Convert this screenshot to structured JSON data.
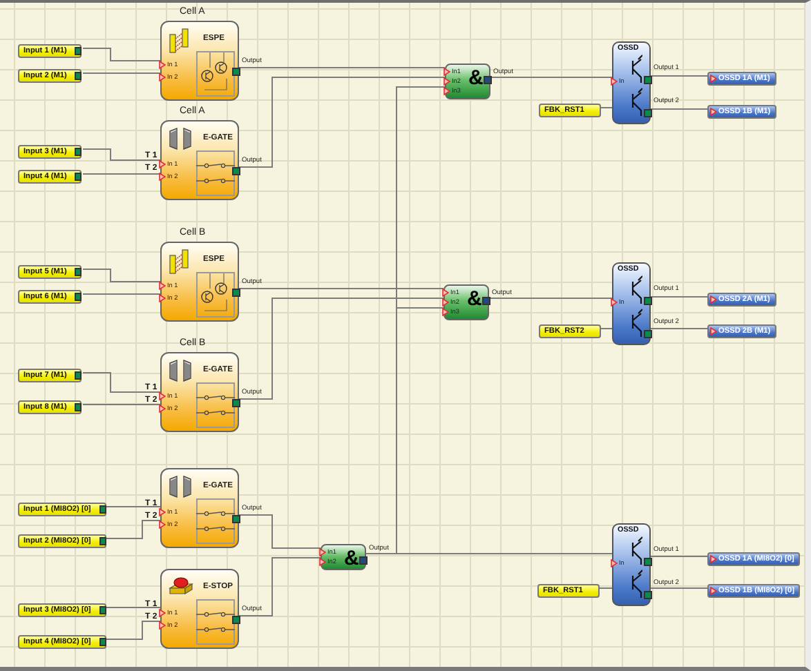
{
  "input_tags": [
    {
      "label": "Input 1 (M1)"
    },
    {
      "label": "Input 2 (M1)"
    },
    {
      "label": "Input 3 (M1)"
    },
    {
      "label": "Input 4 (M1)"
    },
    {
      "label": "Input 5 (M1)"
    },
    {
      "label": "Input 6 (M1)"
    },
    {
      "label": "Input 7 (M1)"
    },
    {
      "label": "Input 8 (M1)"
    },
    {
      "label": "Input 1 (MI8O2) [0]"
    },
    {
      "label": "Input 2 (MI8O2) [0]"
    },
    {
      "label": "Input 3 (MI8O2) [0]"
    },
    {
      "label": "Input 4 (MI8O2) [0]"
    }
  ],
  "function_blocks": [
    {
      "group_label": "Cell A",
      "kind": "espe",
      "title": "ESPE",
      "inputs": [
        {
          "label": "In 1"
        },
        {
          "label": "In 2"
        }
      ],
      "output_label": "Output"
    },
    {
      "group_label": "Cell A",
      "kind": "e-gate",
      "title": "E-GATE",
      "inputs": [
        {
          "label": "In 1",
          "terminal": "T 1"
        },
        {
          "label": "In 2",
          "terminal": "T 2"
        }
      ],
      "output_label": "Output"
    },
    {
      "group_label": "Cell B",
      "kind": "espe",
      "title": "ESPE",
      "inputs": [
        {
          "label": "In 1"
        },
        {
          "label": "In 2"
        }
      ],
      "output_label": "Output"
    },
    {
      "group_label": "Cell B",
      "kind": "e-gate",
      "title": "E-GATE",
      "inputs": [
        {
          "label": "In 1",
          "terminal": "T 1"
        },
        {
          "label": "In 2",
          "terminal": "T 2"
        }
      ],
      "output_label": "Output"
    },
    {
      "kind": "e-gate",
      "title": "E-GATE",
      "inputs": [
        {
          "label": "In 1",
          "terminal": "T 1"
        },
        {
          "label": "In 2",
          "terminal": "T 2"
        }
      ],
      "output_label": "Output"
    },
    {
      "kind": "e-stop",
      "title": "E-STOP",
      "inputs": [
        {
          "label": "In 1",
          "terminal": "T 1"
        },
        {
          "label": "In 2",
          "terminal": "T 2"
        }
      ],
      "output_label": "Output"
    }
  ],
  "and_gates": [
    {
      "symbol": "&",
      "inputs": [
        "In1",
        "In2",
        "In3"
      ],
      "output_label": "Output"
    },
    {
      "symbol": "&",
      "inputs": [
        "In1",
        "In2",
        "In3"
      ],
      "output_label": "Output"
    },
    {
      "symbol": "&",
      "inputs": [
        "In1",
        "In2"
      ],
      "output_label": "Output"
    }
  ],
  "ossd_blocks": [
    {
      "title": "OSSD",
      "input_label": "In",
      "outputs": [
        "Output 1",
        "Output 2"
      ]
    },
    {
      "title": "OSSD",
      "input_label": "In",
      "outputs": [
        "Output 1",
        "Output 2"
      ]
    },
    {
      "title": "OSSD",
      "input_label": "In",
      "outputs": [
        "Output 1",
        "Output 2"
      ]
    }
  ],
  "feedback_tags": [
    {
      "label": "FBK_RST1"
    },
    {
      "label": "FBK_RST2"
    },
    {
      "label": "FBK_RST1"
    }
  ],
  "output_tags": [
    {
      "label": "OSSD 1A (M1)"
    },
    {
      "label": "OSSD 1B (M1)"
    },
    {
      "label": "OSSD 2A (M1)"
    },
    {
      "label": "OSSD 2B (M1)"
    },
    {
      "label": "OSSD 1A (MI8O2) [0]"
    },
    {
      "label": "OSSD 1B (MI8O2) [0]"
    }
  ]
}
